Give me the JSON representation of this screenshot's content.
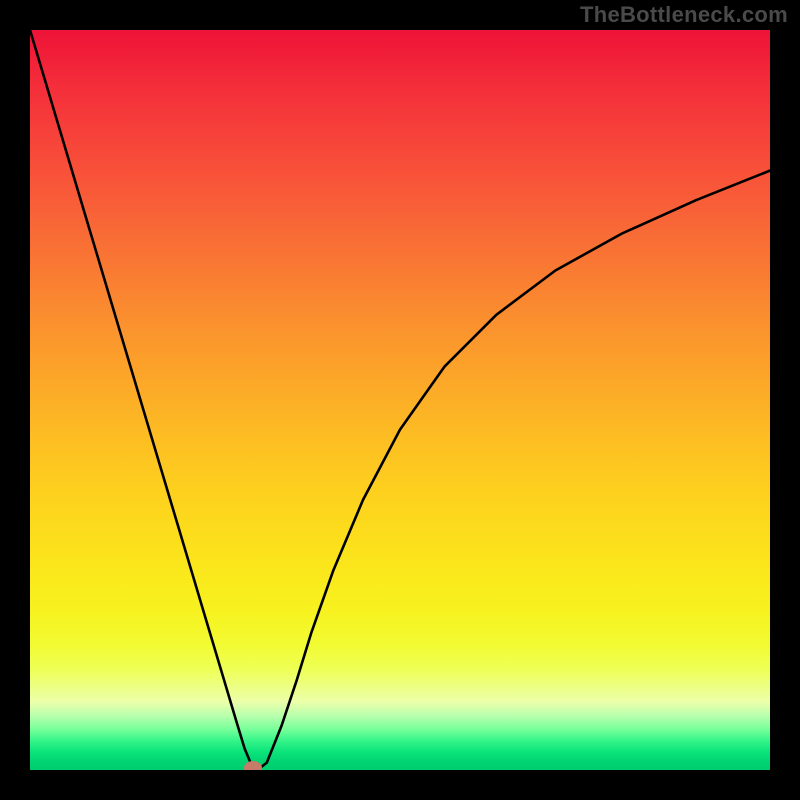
{
  "watermark": "TheBottleneck.com",
  "chart_data": {
    "type": "line",
    "title": "",
    "xlabel": "",
    "ylabel": "",
    "xlim": [
      0,
      100
    ],
    "ylim": [
      0,
      100
    ],
    "grid": false,
    "background_gradient": {
      "direction": "top-to-bottom",
      "stops": [
        {
          "pos": 0.0,
          "color": "#ee1338"
        },
        {
          "pos": 0.5,
          "color": "#fca928"
        },
        {
          "pos": 0.8,
          "color": "#f7f21f"
        },
        {
          "pos": 0.93,
          "color": "#b7ffad"
        },
        {
          "pos": 1.0,
          "color": "#00cd70"
        }
      ]
    },
    "series": [
      {
        "name": "bottleneck-curve",
        "color": "#000000",
        "x": [
          0,
          4,
          8,
          12,
          16,
          20,
          24,
          26,
          28,
          29,
          30,
          31,
          32,
          34,
          36,
          38,
          41,
          45,
          50,
          56,
          63,
          71,
          80,
          90,
          100
        ],
        "y": [
          100,
          86.6,
          73.2,
          59.8,
          46.4,
          33.0,
          19.6,
          12.9,
          6.2,
          2.9,
          0.5,
          0.2,
          1.0,
          6.0,
          12.0,
          18.5,
          27.0,
          36.5,
          46.0,
          54.5,
          61.5,
          67.5,
          72.5,
          77.0,
          81.0
        ]
      }
    ],
    "marker": {
      "x": 30.1,
      "y": 0.3,
      "color": "#c77b69"
    }
  }
}
